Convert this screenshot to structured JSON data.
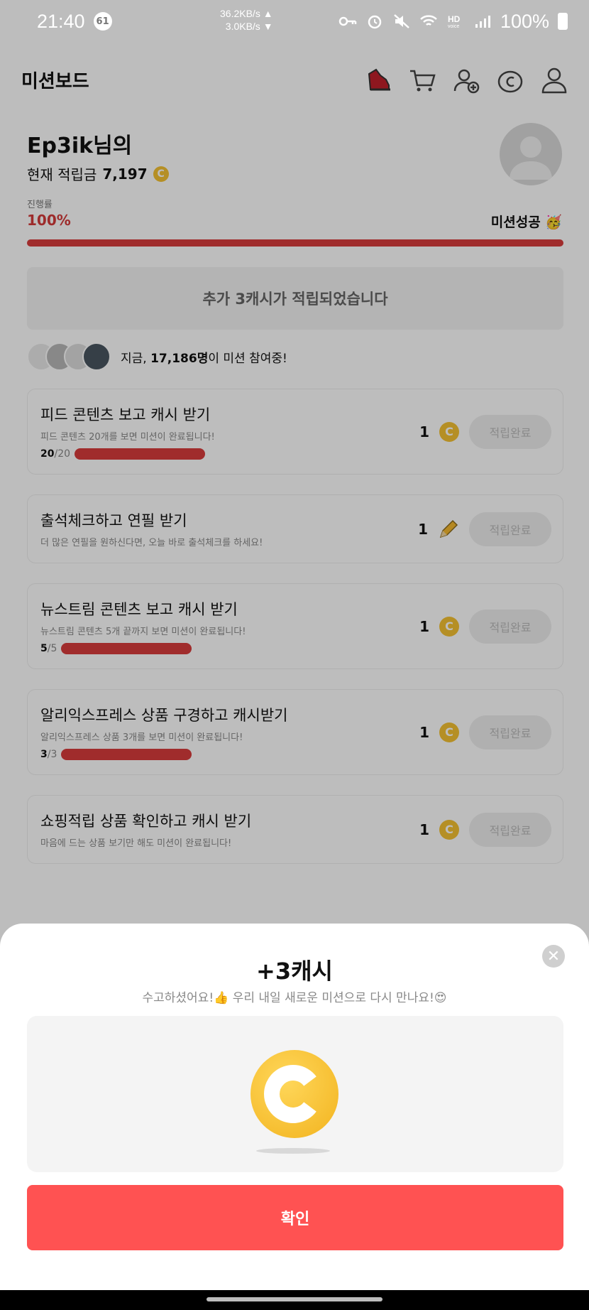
{
  "status_bar": {
    "time": "21:40",
    "notification_count": "61",
    "net_up": "36.2KB/s ▲",
    "net_down": "3.0KB/s ▼",
    "battery": "100%"
  },
  "header": {
    "title": "미션보드",
    "icons": [
      "shoe-icon",
      "cart-icon",
      "add-user-icon",
      "coin-icon",
      "profile-icon"
    ]
  },
  "user": {
    "name": "Ep3ik님의",
    "balance_label": "현재 적립금",
    "balance": "7,197"
  },
  "progress": {
    "label": "진행률",
    "value_text": "100%",
    "value": 1.0,
    "status": "미션성공 🥳"
  },
  "banner": {
    "text": "추가 3캐시가 적립되었습니다"
  },
  "participants": {
    "prefix": "지금,",
    "count": "17,186명",
    "suffix": "이 미션 참여중!"
  },
  "missions": [
    {
      "title": "피드 콘텐츠 보고 캐시 받기",
      "desc": "피드 콘텐츠 20개를 보면 미션이 완료됩니다!",
      "cur": "20",
      "tot": "/20",
      "reward": "1",
      "reward_icon": "coin-icon",
      "button": "적립완료"
    },
    {
      "title": "출석체크하고 연필 받기",
      "desc": "더 많은 연필을 원하신다면, 오늘 바로 출석체크를 하세요!",
      "reward": "1",
      "reward_icon": "pencil-icon",
      "button": "적립완료"
    },
    {
      "title": "뉴스트림 콘텐츠 보고 캐시 받기",
      "desc": "뉴스트림 콘텐츠 5개 끝까지 보면 미션이 완료됩니다!",
      "cur": "5",
      "tot": "/5",
      "reward": "1",
      "reward_icon": "coin-icon",
      "button": "적립완료"
    },
    {
      "title": "알리익스프레스 상품 구경하고 캐시받기",
      "desc": "알리익스프레스 상품 3개를 보면 미션이 완료됩니다!",
      "cur": "3",
      "tot": "/3",
      "reward": "1",
      "reward_icon": "coin-icon",
      "button": "적립완료"
    },
    {
      "title": "쇼핑적립 상품 확인하고 캐시 받기",
      "desc": "마음에 드는 상품 보기만 해도 미션이 완료됩니다!",
      "reward": "1",
      "reward_icon": "coin-icon",
      "button": "적립완료"
    }
  ],
  "sheet": {
    "title": "+3캐시",
    "subtitle": "수고하셨어요!👍 우리 내일 새로운 미션으로 다시 만나요!😍",
    "confirm": "확인",
    "close_icon": "close-icon"
  },
  "colors": {
    "accent": "#ff5252",
    "progress": "#d83c3c",
    "coin": "#f5c232"
  }
}
